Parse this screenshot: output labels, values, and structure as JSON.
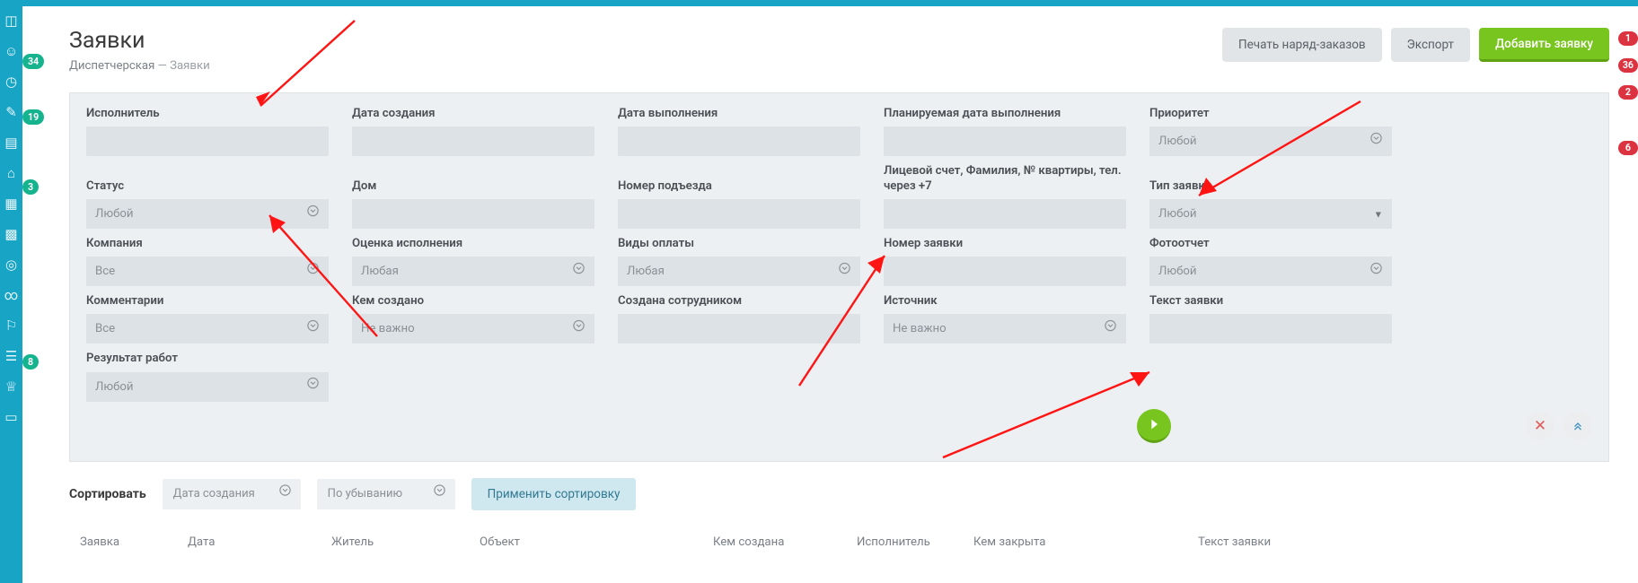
{
  "page": {
    "title": "Заявки",
    "breadcrumb_root": "Диспетчерская",
    "breadcrumb_sep": " — ",
    "breadcrumb_current": "Заявки"
  },
  "header_buttons": {
    "print": "Печать наряд-заказов",
    "export": "Экспорт",
    "add": "Добавить заявку"
  },
  "sidebar_badges": {
    "b1": "34",
    "b2": "19",
    "b3": "3",
    "b4": "8"
  },
  "right_badges": {
    "r1": "1",
    "r2": "36",
    "r3": "2",
    "r4": "6"
  },
  "filters": {
    "executor": {
      "label": "Исполнитель",
      "value": ""
    },
    "created": {
      "label": "Дата создания",
      "value": ""
    },
    "done_date": {
      "label": "Дата выполнения",
      "value": ""
    },
    "planned_date": {
      "label": "Планируемая дата выполнения",
      "value": ""
    },
    "priority": {
      "label": "Приоритет",
      "value": "Любой"
    },
    "status": {
      "label": "Статус",
      "value": "Любой"
    },
    "house": {
      "label": "Дом",
      "value": ""
    },
    "entrance": {
      "label": "Номер подъезда",
      "value": ""
    },
    "account": {
      "label": "Лицевой счет, Фамилия, № квартиры, тел. через +7",
      "value": ""
    },
    "request_type": {
      "label": "Тип заявки",
      "value": "Любой"
    },
    "company": {
      "label": "Компания",
      "value": "Все"
    },
    "exec_rating": {
      "label": "Оценка исполнения",
      "value": "Любая"
    },
    "pay_types": {
      "label": "Виды оплаты",
      "value": "Любая"
    },
    "request_no": {
      "label": "Номер заявки",
      "value": ""
    },
    "photo": {
      "label": "Фотоотчет",
      "value": "Любой"
    },
    "comments": {
      "label": "Комментарии",
      "value": "Все"
    },
    "created_by_role": {
      "label": "Кем создано",
      "value": "Не важно"
    },
    "created_by_staff": {
      "label": "Создана сотрудником",
      "value": ""
    },
    "source": {
      "label": "Источник",
      "value": "Не важно"
    },
    "request_text": {
      "label": "Текст заявки",
      "value": ""
    },
    "work_result": {
      "label": "Результат работ",
      "value": "Любой"
    }
  },
  "sort": {
    "label": "Сортировать",
    "field": "Дата создания",
    "direction": "По убыванию",
    "apply": "Применить сортировку"
  },
  "table": {
    "cols": {
      "request": "Заявка",
      "date": "Дата",
      "resident": "Житель",
      "object": "Объект",
      "created_by": "Кем создана",
      "executor": "Исполнитель",
      "closed_by": "Кем закрыта",
      "text": "Текст заявки"
    }
  }
}
